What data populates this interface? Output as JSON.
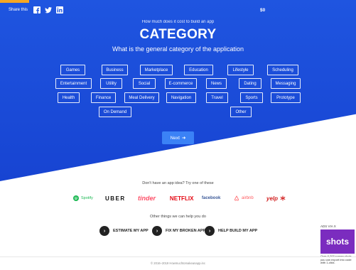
{
  "header": {
    "share_label": "Share this",
    "price": "$0",
    "share_icons": [
      "facebook-icon",
      "twitter-icon",
      "linkedin-icon"
    ]
  },
  "intro": {
    "subtitle": "How much does it cost to build an app",
    "title": "CATEGORY",
    "question": "What is the general category of the application"
  },
  "options": [
    "Games",
    "Business",
    "Marketplace",
    "Education",
    "Lifestyle",
    "Scheduling",
    "Entertainment",
    "Utility",
    "Social",
    "E-commerce",
    "News",
    "Dating",
    "Messaging",
    "Health",
    "Finance",
    "Meal Delivery",
    "Navigation",
    "Travel",
    "Sports",
    "Prototype",
    "On Demand",
    "Other"
  ],
  "next_button": {
    "label": "Next",
    "icon": "arrow-right-icon"
  },
  "ideas": {
    "label": "Don't have an app idea? Try one of these",
    "brands": [
      "Spotify",
      "UBER",
      "tinder",
      "NETFLIX",
      "facebook",
      "airbnb",
      "yelp"
    ]
  },
  "help": {
    "label": "Other things we can help you do",
    "items": [
      "ESTIMATE MY APP",
      "FIX MY BROKEN APP",
      "HELP BUILD MY APP"
    ]
  },
  "ad": {
    "label": "ADS VIA X",
    "brand": "shots",
    "text": "Over 6,000 screen shots you can export into code with 1-click."
  },
  "footer": {
    "text": "© 2016–2019 Howmuchtomakeanapp.inc"
  },
  "colors": {
    "hero": "#1f55e0",
    "accent": "#f5a623",
    "next_button": "#3b82f6"
  }
}
